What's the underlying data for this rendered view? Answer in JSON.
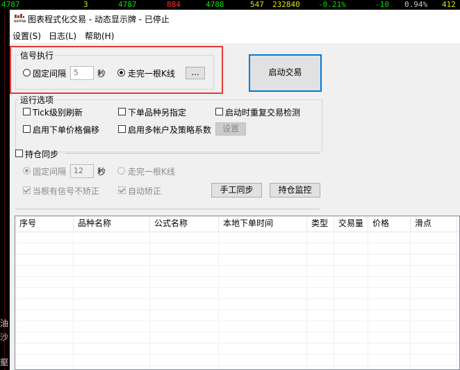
{
  "background": {
    "ticker": [
      {
        "text": "4787",
        "color": "#00e000"
      },
      {
        "text": "3",
        "color": "#e0e000"
      },
      {
        "text": "4787",
        "color": "#00e000"
      },
      {
        "text": "884",
        "color": "#ff3030"
      },
      {
        "text": "4788",
        "color": "#00e000"
      },
      {
        "text": "547",
        "color": "#e0e000"
      },
      {
        "text": "232840",
        "color": "#e0e000"
      },
      {
        "text": "-0.21%",
        "color": "#00e000"
      },
      {
        "text": "-10",
        "color": "#00e000"
      },
      {
        "text": "0.94%",
        "color": "#c8c8c8"
      },
      {
        "text": "412",
        "color": "#e0e000"
      }
    ],
    "side_chars": [
      "油",
      "沙",
      "壑"
    ]
  },
  "window": {
    "title": "图表程式化交易 - 动态显示牌 - 已停止",
    "icon_caption": "QUITOA"
  },
  "menu": {
    "items": [
      "设置(S)",
      "日志(L)",
      "帮助(H)"
    ]
  },
  "signal": {
    "group_title": "信号执行",
    "fixed_interval_label": "固定间隔",
    "fixed_interval_value": "5",
    "seconds_label": "秒",
    "kline_label": "走完一根K线",
    "selected": "kline",
    "ellipsis_label": "...",
    "start_button": "启动交易",
    "highlight_color": "#e53935"
  },
  "run_options": {
    "group_title": "运行选项",
    "items": [
      {
        "label": "Tick级别刷新",
        "checked": false
      },
      {
        "label": "下单品种另指定",
        "checked": false
      },
      {
        "label": "启动时重复交易检测",
        "checked": false
      },
      {
        "label": "启用下单价格偏移",
        "checked": false
      },
      {
        "label": "启用多帐户及策略系数",
        "checked": false
      }
    ],
    "settings_button": "设置"
  },
  "position_sync": {
    "title": "持仓同步",
    "checked": false,
    "fixed_interval_label": "固定间隔",
    "fixed_interval_value": "12",
    "seconds_label": "秒",
    "kline_label": "走完一根K线",
    "selected": "fixed",
    "no_correct_label": "当根有信号不矫正",
    "no_correct_checked": true,
    "auto_correct_label": "自动矫正",
    "auto_correct_checked": true,
    "manual_sync_button": "手工同步",
    "monitor_button": "持仓监控"
  },
  "table": {
    "columns": [
      "序号",
      "品种名称",
      "公式名称",
      "本地下单时间",
      "类型",
      "交易量",
      "价格",
      "滑点"
    ],
    "rows": []
  }
}
